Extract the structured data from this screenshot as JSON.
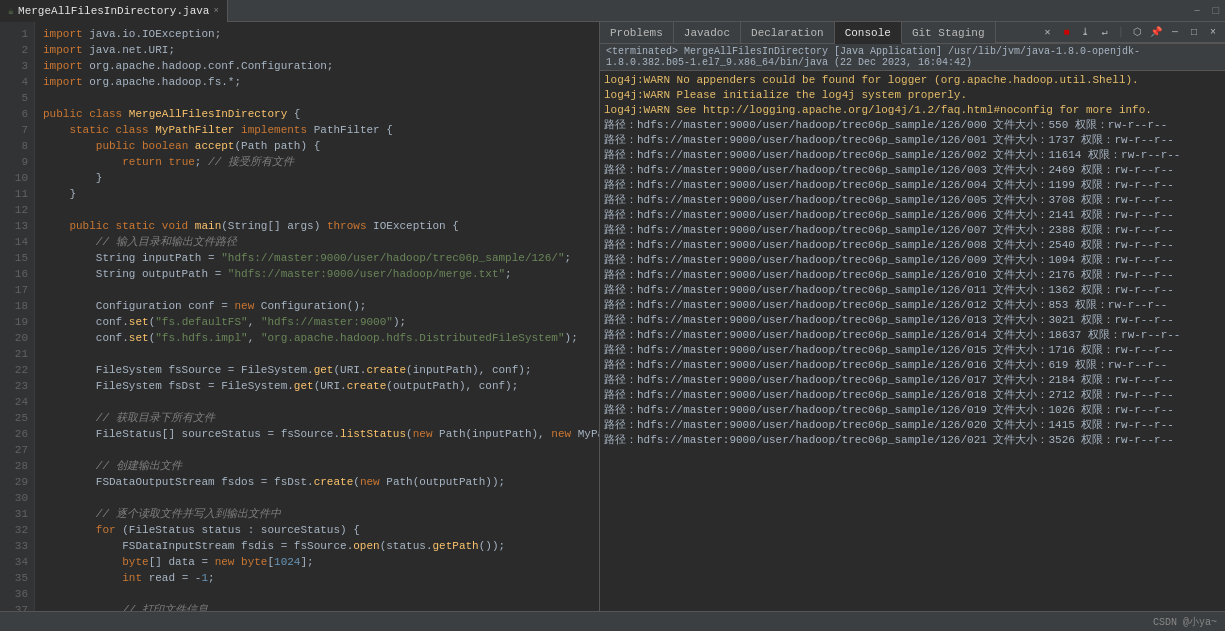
{
  "editor": {
    "tab_label": "MergeAllFilesInDirectory.java",
    "tab_close": "×",
    "minimize": "−",
    "maximize": "□"
  },
  "right_panel": {
    "tabs": [
      "Problems",
      "Javadoc",
      "Declaration",
      "Console",
      "Git Staging"
    ],
    "active_tab": "Console",
    "terminated_header": "<terminated> MergeAllFilesInDirectory [Java Application] /usr/lib/jvm/java-1.8.0-openjdk-1.8.0.382.b05-1.el7_9.x86_64/bin/java (22 Dec 2023, 16:04:42)",
    "warn1": "log4j:WARN No appenders could be found for logger (org.apache.hadoop.util.Shell).",
    "warn2": "log4j:WARN Please initialize the log4j system properly.",
    "warn3": "log4j:WARN See http://logging.apache.org/log4j/1.2/faq.html#noconfig for more info.",
    "console_lines": [
      "路径：hdfs://master:9000/user/hadoop/trec06p_sample/126/000\t文件大小：550\t权限：rw-r--r--",
      "路径：hdfs://master:9000/user/hadoop/trec06p_sample/126/001\t文件大小：1737\t权限：rw-r--r--",
      "路径：hdfs://master:9000/user/hadoop/trec06p_sample/126/002\t文件大小：11614\t权限：rw-r--r--",
      "路径：hdfs://master:9000/user/hadoop/trec06p_sample/126/003\t文件大小：2469\t权限：rw-r--r--",
      "路径：hdfs://master:9000/user/hadoop/trec06p_sample/126/004\t文件大小：1199\t权限：rw-r--r--",
      "路径：hdfs://master:9000/user/hadoop/trec06p_sample/126/005\t文件大小：3708\t权限：rw-r--r--",
      "路径：hdfs://master:9000/user/hadoop/trec06p_sample/126/006\t文件大小：2141\t权限：rw-r--r--",
      "路径：hdfs://master:9000/user/hadoop/trec06p_sample/126/007\t文件大小：2388\t权限：rw-r--r--",
      "路径：hdfs://master:9000/user/hadoop/trec06p_sample/126/008\t文件大小：2540\t权限：rw-r--r--",
      "路径：hdfs://master:9000/user/hadoop/trec06p_sample/126/009\t文件大小：1094\t权限：rw-r--r--",
      "路径：hdfs://master:9000/user/hadoop/trec06p_sample/126/010\t文件大小：2176\t权限：rw-r--r--",
      "路径：hdfs://master:9000/user/hadoop/trec06p_sample/126/011\t文件大小：1362\t权限：rw-r--r--",
      "路径：hdfs://master:9000/user/hadoop/trec06p_sample/126/012\t文件大小：853\t权限：rw-r--r--",
      "路径：hdfs://master:9000/user/hadoop/trec06p_sample/126/013\t文件大小：3021\t权限：rw-r--r--",
      "路径：hdfs://master:9000/user/hadoop/trec06p_sample/126/014\t文件大小：18637\t权限：rw-r--r--",
      "路径：hdfs://master:9000/user/hadoop/trec06p_sample/126/015\t文件大小：1716\t权限：rw-r--r--",
      "路径：hdfs://master:9000/user/hadoop/trec06p_sample/126/016\t文件大小：619\t权限：rw-r--r--",
      "路径：hdfs://master:9000/user/hadoop/trec06p_sample/126/017\t文件大小：2184\t权限：rw-r--r--",
      "路径：hdfs://master:9000/user/hadoop/trec06p_sample/126/018\t文件大小：2712\t权限：rw-r--r--",
      "路径：hdfs://master:9000/user/hadoop/trec06p_sample/126/019\t文件大小：1026\t权限：rw-r--r--",
      "路径：hdfs://master:9000/user/hadoop/trec06p_sample/126/020\t文件大小：1415\t权限：rw-r--r--",
      "路径：hdfs://master:9000/user/hadoop/trec06p_sample/126/021\t文件大小：3526\t权限：rw-r--r--"
    ]
  },
  "bottom_bar": {
    "brand": "CSDN @小ya~"
  }
}
